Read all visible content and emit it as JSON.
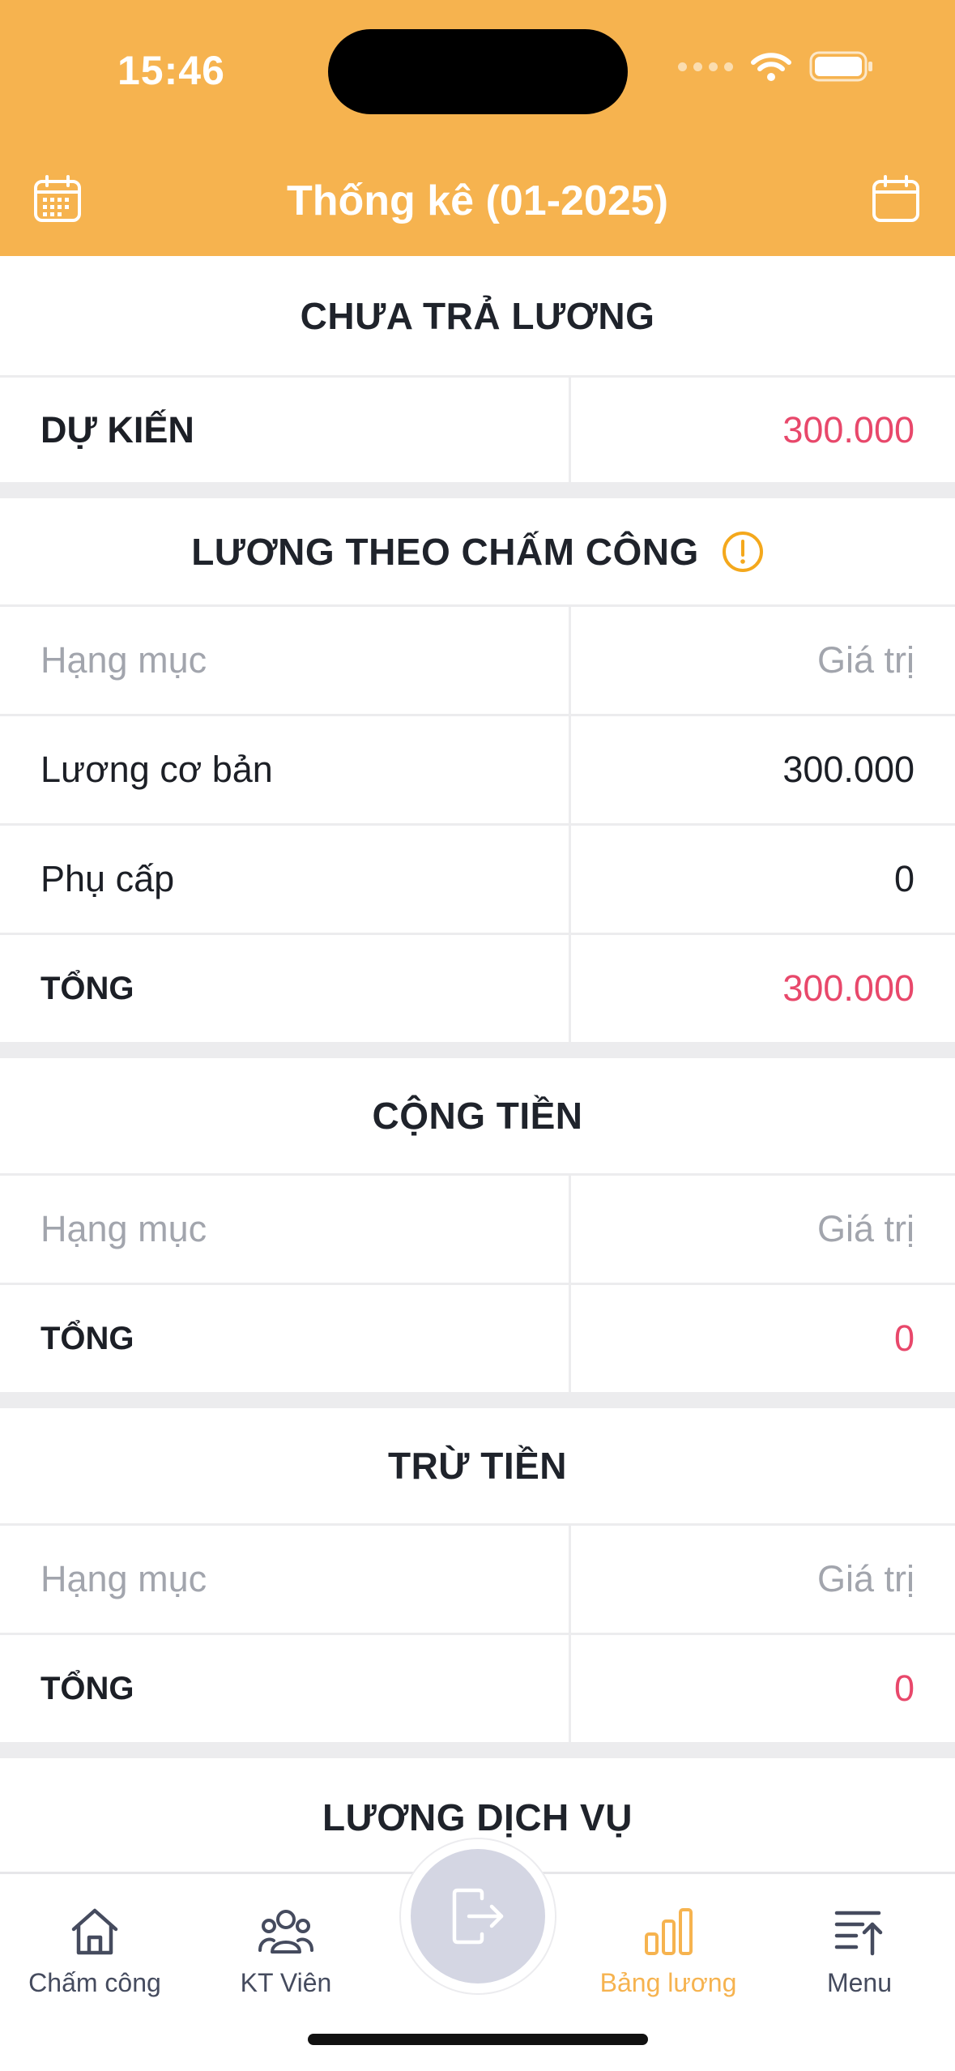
{
  "status_bar": {
    "time": "15:46"
  },
  "header": {
    "title": "Thống kê (01-2025)",
    "left_icon": "calendar-grid-icon",
    "right_icon": "calendar-icon"
  },
  "sections": {
    "unpaid": {
      "title": "CHƯA TRẢ LƯƠNG",
      "row_label": "DỰ KIẾN",
      "row_value": "300.000"
    },
    "attendance": {
      "title": "LƯƠNG THEO CHẤM CÔNG",
      "col_category": "Hạng mục",
      "col_value": "Giá trị",
      "rows": [
        {
          "label": "Lương cơ bản",
          "value": "300.000"
        },
        {
          "label": "Phụ cấp",
          "value": "0"
        }
      ],
      "total_label": "TỔNG",
      "total_value": "300.000"
    },
    "additions": {
      "title": "CỘNG TIỀN",
      "col_category": "Hạng mục",
      "col_value": "Giá trị",
      "total_label": "TỔNG",
      "total_value": "0"
    },
    "deductions": {
      "title": "TRỪ TIỀN",
      "col_category": "Hạng mục",
      "col_value": "Giá trị",
      "total_label": "TỔNG",
      "total_value": "0"
    },
    "service": {
      "title": "LƯƠNG DỊCH VỤ"
    }
  },
  "nav": {
    "items": [
      {
        "label": "Chấm công",
        "icon": "home-icon"
      },
      {
        "label": "KT Viên",
        "icon": "users-icon"
      },
      {
        "label": "Bảng lương",
        "icon": "bar-chart-icon",
        "active": true
      },
      {
        "label": "Menu",
        "icon": "menu-upload-icon"
      }
    ],
    "center_icon": "exit-icon"
  },
  "colors": {
    "accent": "#f6b34f",
    "highlight": "#e8486b",
    "muted": "#a2a5ad"
  }
}
